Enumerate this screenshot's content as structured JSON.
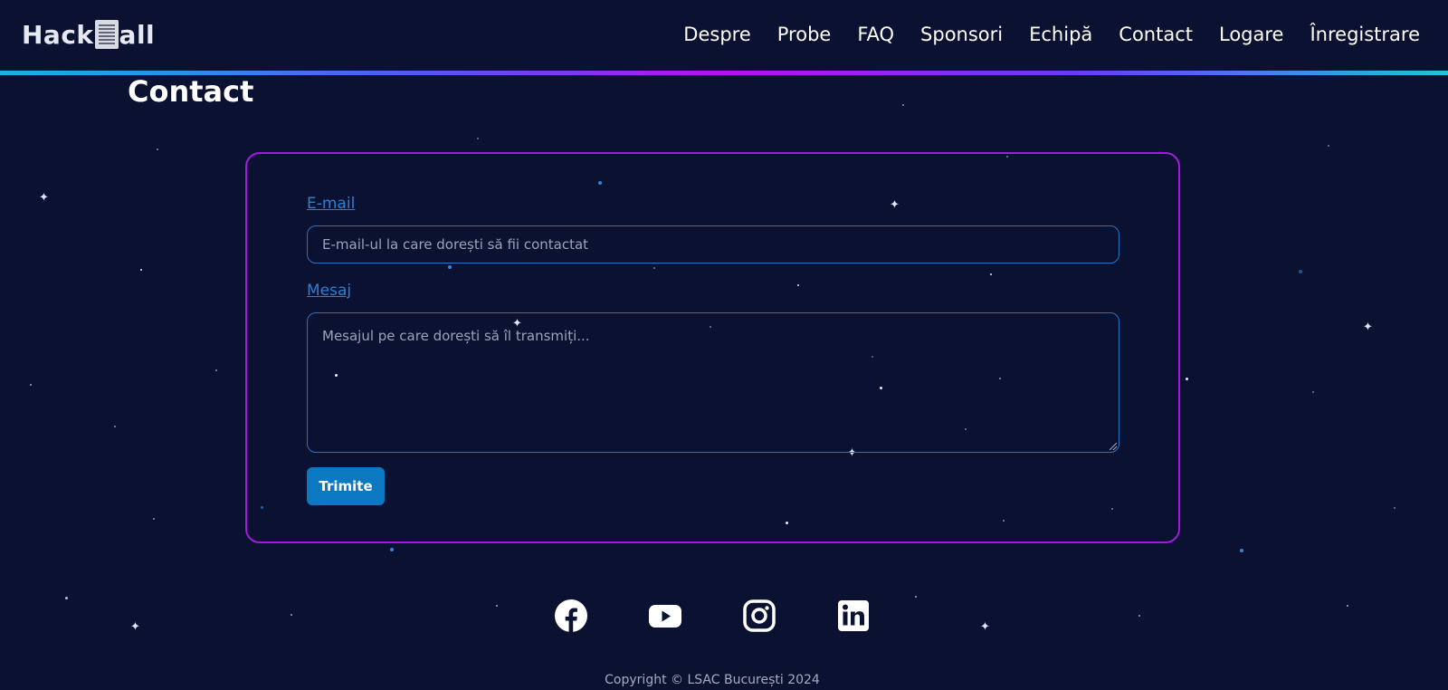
{
  "brand": {
    "logo_text_left": "Hack",
    "logo_text_right": "all"
  },
  "nav": {
    "items": [
      "Despre",
      "Probe",
      "FAQ",
      "Sponsori",
      "Echipă",
      "Contact",
      "Logare",
      "Înregistrare"
    ]
  },
  "page": {
    "title": "Contact"
  },
  "form": {
    "email_label": "E-mail",
    "email_placeholder": "E-mail-ul la care dorești să fii contactat",
    "message_label": "Mesaj",
    "message_placeholder": "Mesajul pe care dorești să îl transmiți...",
    "submit_label": "Trimite"
  },
  "socials": [
    "facebook-icon",
    "youtube-icon",
    "instagram-icon",
    "linkedin-icon"
  ],
  "footer": {
    "copyright": "Copyright © LSAC București 2024"
  },
  "colors": {
    "background": "#0b1231",
    "card_border": "#a517e3",
    "accent_blue": "#0b78c2",
    "label_blue": "#2f7fd0"
  }
}
